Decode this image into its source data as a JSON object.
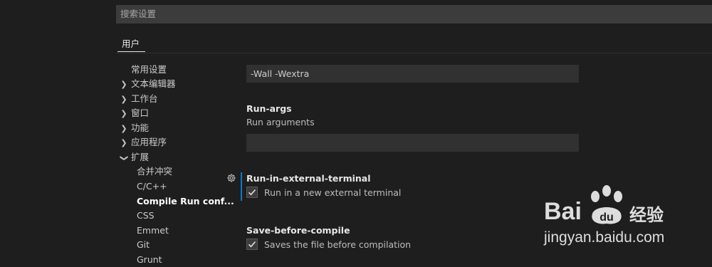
{
  "search": {
    "placeholder": "搜索设置"
  },
  "tabs": [
    {
      "label": "用户"
    }
  ],
  "tree": [
    {
      "label": "常用设置",
      "chevron": ""
    },
    {
      "label": "文本编辑器",
      "chevron": "right"
    },
    {
      "label": "工作台",
      "chevron": "right"
    },
    {
      "label": "窗口",
      "chevron": "right"
    },
    {
      "label": "功能",
      "chevron": "right"
    },
    {
      "label": "应用程序",
      "chevron": "right"
    },
    {
      "label": "扩展",
      "chevron": "down"
    },
    {
      "label": "合并冲突",
      "chevron": ""
    },
    {
      "label": "C/C++",
      "chevron": ""
    },
    {
      "label": "Compile Run conf...",
      "chevron": "",
      "selected": true
    },
    {
      "label": "CSS",
      "chevron": ""
    },
    {
      "label": "Emmet",
      "chevron": ""
    },
    {
      "label": "Git",
      "chevron": ""
    },
    {
      "label": "Grunt",
      "chevron": ""
    }
  ],
  "settings": {
    "flags_value": "-Wall -Wextra",
    "run_args": {
      "title": "Run-args",
      "description": "Run arguments",
      "value": ""
    },
    "run_in_external_terminal": {
      "title": "Run-in-external-terminal",
      "checkbox_label": "Run in a new external terminal",
      "checked": true
    },
    "save_before_compile": {
      "title": "Save-before-compile",
      "checkbox_label": "Saves the file before compilation",
      "checked": true
    }
  },
  "watermark": {
    "brand": "Bai",
    "brand_suffix": "经验",
    "url": "jingyan.baidu.com"
  },
  "colors": {
    "background": "#1e1e1e",
    "input_background": "#313131",
    "accent": "#0a7aca"
  }
}
